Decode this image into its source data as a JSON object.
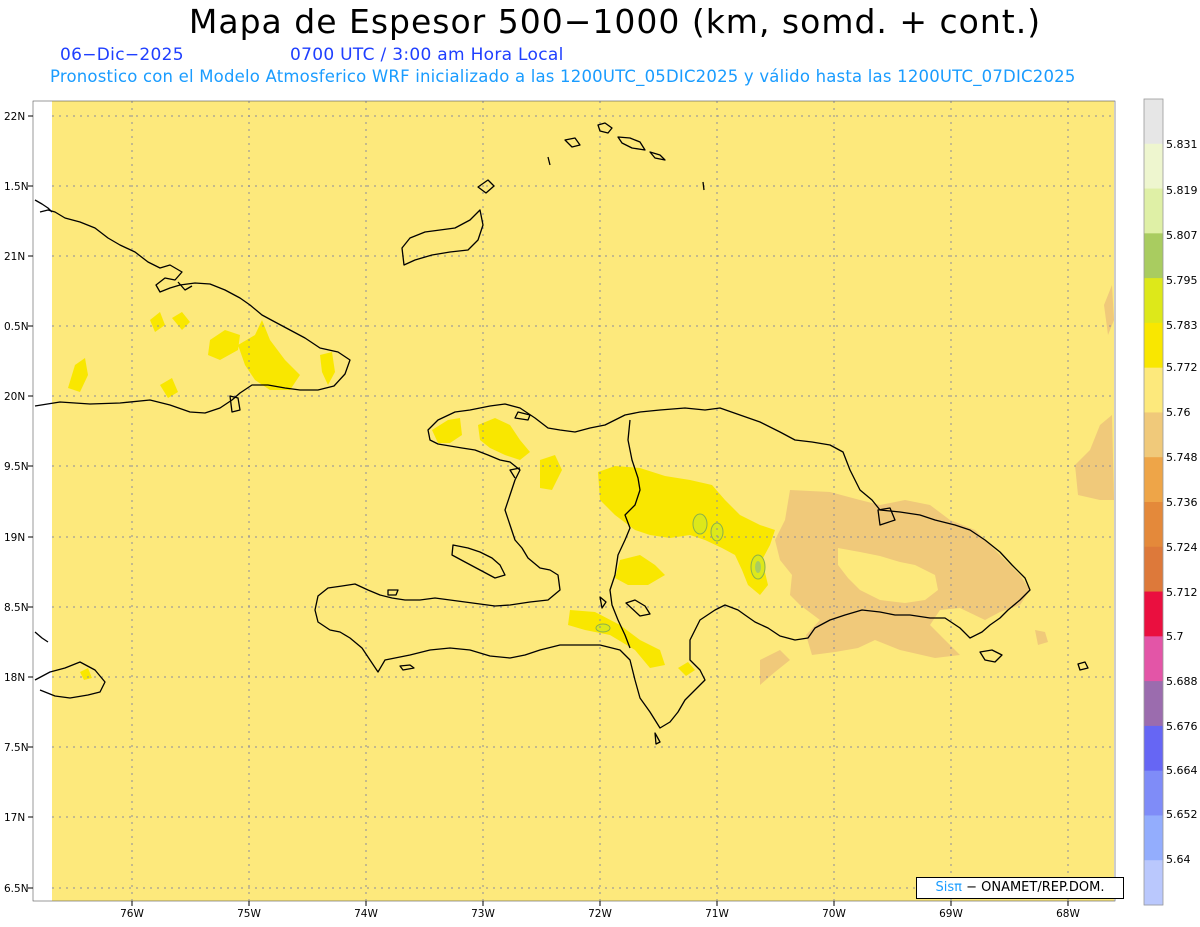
{
  "header": {
    "title": "Mapa de Espesor 500−1000 (km, somd. + cont.)",
    "date": "06−Dic−2025",
    "time": "0700 UTC / 3:00 am Hora Local",
    "subtitle": "Pronostico con el Modelo Atmosferico WRF inicializado a las 1200UTC_05DIC2025 y válido hasta las  1200UTC_07DIC2025"
  },
  "map": {
    "region": "Hispaniola",
    "background_color": "#fde97c",
    "lat_labels": [
      "22N",
      "1.5N",
      "21N",
      "0.5N",
      "20N",
      "9.5N",
      "19N",
      "8.5N",
      "18N",
      "7.5N",
      "17N",
      "6.5N"
    ],
    "lon_labels": [
      "76W",
      "75W",
      "74W",
      "73W",
      "72W",
      "71W",
      "70W",
      "69W",
      "68W"
    ],
    "grid": "dotted"
  },
  "colorbar": {
    "labels": [
      "5.831",
      "5.819",
      "5.807",
      "5.795",
      "5.783",
      "5.772",
      "5.76",
      "5.748",
      "5.736",
      "5.724",
      "5.712",
      "5.7",
      "5.688",
      "5.676",
      "5.664",
      "5.652",
      "5.64"
    ],
    "colors": [
      "#e6e6e6",
      "#eef6cf",
      "#dff0a6",
      "#a9cc60",
      "#dde81a",
      "#f9e700",
      "#fde97c",
      "#f0c97a",
      "#eea548",
      "#e4893a",
      "#dd793a",
      "#ea0f3f",
      "#e355a7",
      "#9b6cae",
      "#6666f4",
      "#7f8cf8",
      "#93adfd",
      "#bac8fd"
    ]
  },
  "credit": {
    "pi": "Sisπ",
    "text": "− ONAMET/REP.DOM."
  }
}
